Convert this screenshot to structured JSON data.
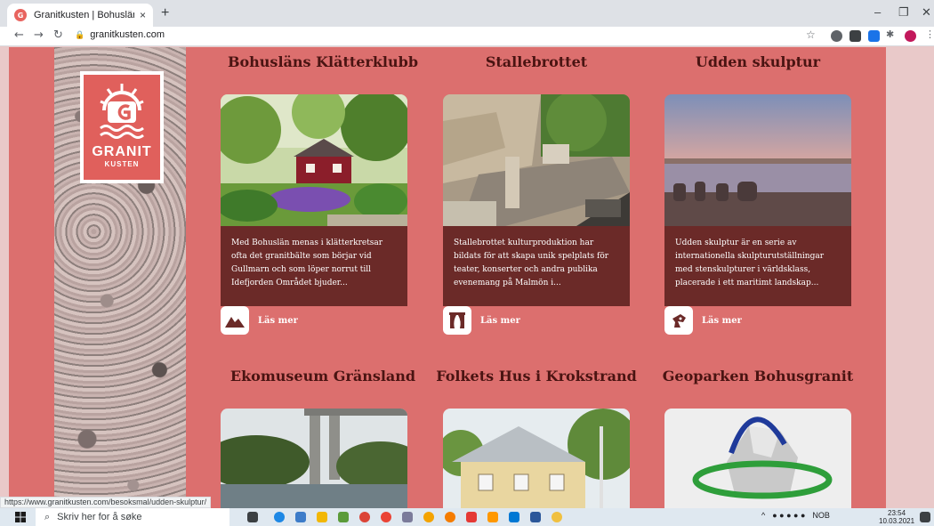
{
  "browser": {
    "tab_title": "Granitkusten | Bohuslänsk granit",
    "tab_close": "×",
    "new_tab": "+",
    "url": "granitkusten.com",
    "status_url": "https://www.granitkusten.com/besoksmal/udden-skulptur/"
  },
  "logo": {
    "line1": "GRANIT",
    "line2": "KUSTEN"
  },
  "cards": [
    {
      "title": "Bohusläns Klätterklubb",
      "description": "Med Bohuslän menas i klätterkretsar ofta det granitbälte som börjar vid Gullmarn och som löper norrut till Idefjorden Området bjuder...",
      "more": "Läs mer",
      "icon": "mountain-icon"
    },
    {
      "title": "Stallebrottet",
      "description": "Stallebrottet kulturproduktion har bildats för att skapa unik spelplats för teater, konserter och andra publika evenemang på Malmön i...",
      "more": "Läs mer",
      "icon": "theater-icon"
    },
    {
      "title": "Udden skulptur",
      "description": "Udden skulptur är en serie av internationella skulpturutställningar med stenskulpturer i världsklass, placerade i ett maritimt landskap...",
      "more": "Läs mer",
      "icon": "sculpture-icon"
    },
    {
      "title": "Ekomuseum Gränsland"
    },
    {
      "title": "Folkets Hus i Krokstrand"
    },
    {
      "title": "Geoparken Bohusgranit"
    }
  ],
  "taskbar": {
    "search_placeholder": "Skriv her for å søke",
    "lang": "NOB",
    "time": "23:54",
    "date": "10.03.2021"
  },
  "colors": {
    "page_bg": "#dc6f6e",
    "card_desc_bg": "#6b2a28",
    "heading": "#4a1412"
  }
}
